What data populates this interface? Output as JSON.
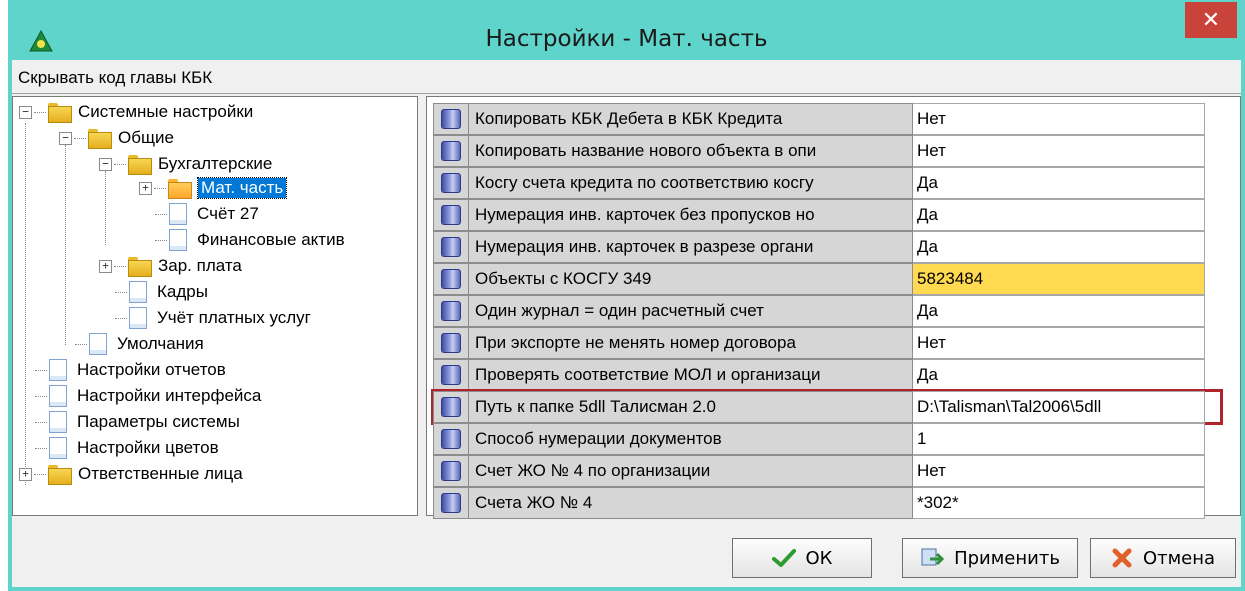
{
  "window": {
    "title": "Настройки - Мат. часть",
    "close_glyph": "✕"
  },
  "hint": "Скрывать код главы КБК",
  "tree": {
    "nodes": [
      {
        "label": "Системные настройки",
        "icon": "folder-icon",
        "expander": "−"
      },
      {
        "label": "Общие",
        "icon": "folder-icon",
        "expander": "−"
      },
      {
        "label": "Бухгалтерские",
        "icon": "folder-icon",
        "expander": "−"
      },
      {
        "label": "Мат. часть",
        "icon": "folder-open-icon",
        "expander": "+",
        "selected": true
      },
      {
        "label": "Счёт 27",
        "icon": "document-icon"
      },
      {
        "label": "Финансовые актив",
        "icon": "document-icon"
      },
      {
        "label": "Зар. плата",
        "icon": "folder-icon",
        "expander": "+"
      },
      {
        "label": "Кадры",
        "icon": "document-icon"
      },
      {
        "label": "Учёт платных услуг",
        "icon": "document-icon"
      },
      {
        "label": "Умолчания",
        "icon": "document-icon"
      },
      {
        "label": "Настройки отчетов",
        "icon": "document-icon"
      },
      {
        "label": "Настройки интерфейса",
        "icon": "document-icon"
      },
      {
        "label": "Параметры системы",
        "icon": "document-icon"
      },
      {
        "label": "Настройки цветов",
        "icon": "document-icon"
      },
      {
        "label": "Ответственные лица",
        "icon": "folder-icon",
        "expander": "+"
      }
    ]
  },
  "settings": {
    "rows": [
      {
        "name": "Копировать КБК Дебета в КБК Кредита",
        "value": "Нет"
      },
      {
        "name": "Копировать название нового объекта в опи",
        "value": "Нет"
      },
      {
        "name": "Косгу счета кредита по соответствию косгу",
        "value": "Да"
      },
      {
        "name": "Нумерация инв. карточек без пропусков но",
        "value": "Да"
      },
      {
        "name": "Нумерация инв. карточек в разрезе органи",
        "value": "Да"
      },
      {
        "name": "Объекты с КОСГУ 349",
        "value": "5823484",
        "highlight": true
      },
      {
        "name": "Один журнал = один расчетный счет",
        "value": "Да"
      },
      {
        "name": "При экспорте не менять номер договора",
        "value": "Нет"
      },
      {
        "name": "Проверять соответствие МОЛ и организаци",
        "value": "Да"
      },
      {
        "name": "Путь к папке 5dll Талисман 2.0",
        "value": "D:\\Talisman\\Tal2006\\5dll",
        "boxed": true
      },
      {
        "name": "Способ нумерации документов",
        "value": "1"
      },
      {
        "name": "Счет ЖО № 4 по организации",
        "value": "Нет"
      },
      {
        "name": "Счета ЖО № 4",
        "value": "*302*"
      }
    ]
  },
  "buttons": {
    "ok": "ОК",
    "apply": "Применить",
    "cancel": "Отмена"
  },
  "colors": {
    "titlebar": "#5fd4ca",
    "close": "#c9433b",
    "selection": "#0078d7",
    "highlight_value": "#ffd94f",
    "box_outline": "#b0232a"
  }
}
